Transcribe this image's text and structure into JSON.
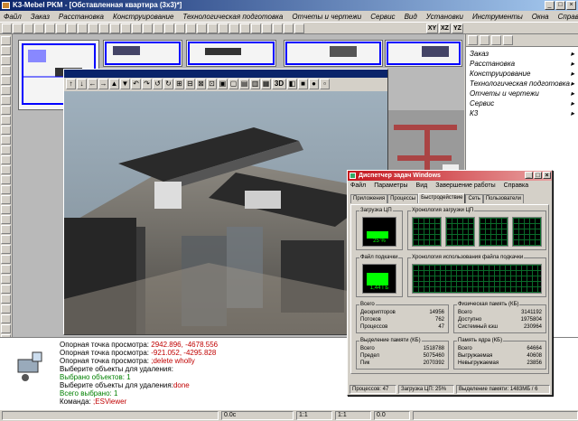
{
  "app": {
    "title": "K3-Mebel PKM - [Обставленная квартира (3х3)*]",
    "window_buttons": [
      "_",
      "□",
      "×"
    ]
  },
  "menu": [
    "Файл",
    "Заказ",
    "Расстановка",
    "Конструирование",
    "Технологическая подготовка",
    "Отчеты и чертежи",
    "Сервис",
    "Вид",
    "Установки",
    "Инструменты",
    "Окна",
    "Справка"
  ],
  "toolbar": {
    "icons": [
      "pointer-icon",
      "line-icon",
      "point-icon",
      "new-icon",
      "open-icon",
      "save-icon",
      "print-icon",
      "cut-icon",
      "copy-icon",
      "paste-icon",
      "undo-icon",
      "redo-icon",
      "x-icon",
      "plus-icon",
      "minus-icon",
      "zoom-in-icon",
      "zoom-out-icon",
      "zoom-window-icon",
      "pan-icon",
      "refresh-icon",
      "view-icon",
      "grid-icon",
      "ortho-icon",
      "snap-icon",
      "layer-icon",
      "color-icon",
      "line-type-icon",
      "measure-icon"
    ],
    "axis_buttons": [
      "XY",
      "XZ",
      "YZ"
    ]
  },
  "right_panel": {
    "items": [
      "Заказ",
      "Расстановка",
      "Конструирование",
      "Технологическая подготовка",
      "Отчеты и чертежи",
      "Сервис",
      "К3"
    ]
  },
  "viewer": {
    "tool_labels": [
      "↑",
      "↓",
      "←",
      "→",
      "▲",
      "▼",
      "↶",
      "↷",
      "↺",
      "↻",
      "⊞",
      "⊟",
      "⊠",
      "⊡",
      "▣",
      "▢",
      "▤",
      "▥",
      "▦",
      "3D",
      "◧",
      "■",
      "●",
      "▫"
    ]
  },
  "command_log": [
    {
      "text": "Опорная точка просмотра: ",
      "value": "2942.896, -4678.556",
      "color": "#000",
      "vcolor": "#c00000"
    },
    {
      "text": "Опорная точка просмотра: ",
      "value": "-921.052, -4295.828",
      "color": "#000",
      "vcolor": "#c00000"
    },
    {
      "text": "Опорная точка просмотра: ",
      "value": ";delete wholly",
      "color": "#000",
      "vcolor": "#c00000"
    },
    {
      "text": "Выберите объекты для удаления:",
      "value": "",
      "color": "#000",
      "vcolor": "#000"
    },
    {
      "text": "Выбрано объектов: 1",
      "value": "",
      "color": "#008000",
      "vcolor": "#000"
    },
    {
      "text": "Выберите объекты для удаления:",
      "value": "done",
      "color": "#000",
      "vcolor": "#c00000"
    },
    {
      "text": "Всего выбрано: 1",
      "value": "",
      "color": "#008000",
      "vcolor": "#000"
    },
    {
      "text": "Команда: ",
      "value": ";ESViewer",
      "color": "#000",
      "vcolor": "#c00000"
    }
  ],
  "statusbar": {
    "cells": [
      "",
      "0.0с",
      "1:1",
      "1:1",
      "0.0",
      ""
    ]
  },
  "task_manager": {
    "title": "Диспетчер задач Windows",
    "menu": [
      "Файл",
      "Параметры",
      "Вид",
      "Завершение работы",
      "Справка"
    ],
    "tabs": [
      "Приложения",
      "Процессы",
      "Быстродействие",
      "Сеть",
      "Пользователи"
    ],
    "active_tab": 2,
    "cpu_label": "Загрузка ЦП",
    "cpu_value": "25 %",
    "cpu_fraction": 0.25,
    "cpu_history_label": "Хронология загрузки ЦП",
    "pf_label": "Файл подкачки",
    "pf_value": "1,44 ГБ",
    "pf_fraction": 0.45,
    "pf_history_label": "Хронология использования файла подкачки",
    "totals": {
      "label": "Всего",
      "rows": [
        [
          "Дескрипторов",
          "14956"
        ],
        [
          "Потоков",
          "762"
        ],
        [
          "Процессов",
          "47"
        ]
      ]
    },
    "physical": {
      "label": "Физическая память (КБ)",
      "rows": [
        [
          "Всего",
          "3141192"
        ],
        [
          "Доступно",
          "1975804"
        ],
        [
          "Системный кэш",
          "230964"
        ]
      ]
    },
    "commit": {
      "label": "Выделение памяти (КБ)",
      "rows": [
        [
          "Всего",
          "1518788"
        ],
        [
          "Предел",
          "5075460"
        ],
        [
          "Пик",
          "2070392"
        ]
      ]
    },
    "kernel": {
      "label": "Память ядра (КБ)",
      "rows": [
        [
          "Всего",
          "64664"
        ],
        [
          "Выгружаемая",
          "40608"
        ],
        [
          "Невыгружаемая",
          "23856"
        ]
      ]
    },
    "status": [
      "Процессов: 47",
      "Загрузка ЦП: 25%",
      "Выделение памяти: 1483МБ / 6"
    ]
  },
  "colors": {
    "title_active": "#0a246a",
    "task_manager_title": "#c4141c",
    "meter_green": "#00ff00",
    "log_red": "#c00000",
    "log_green": "#008000"
  }
}
